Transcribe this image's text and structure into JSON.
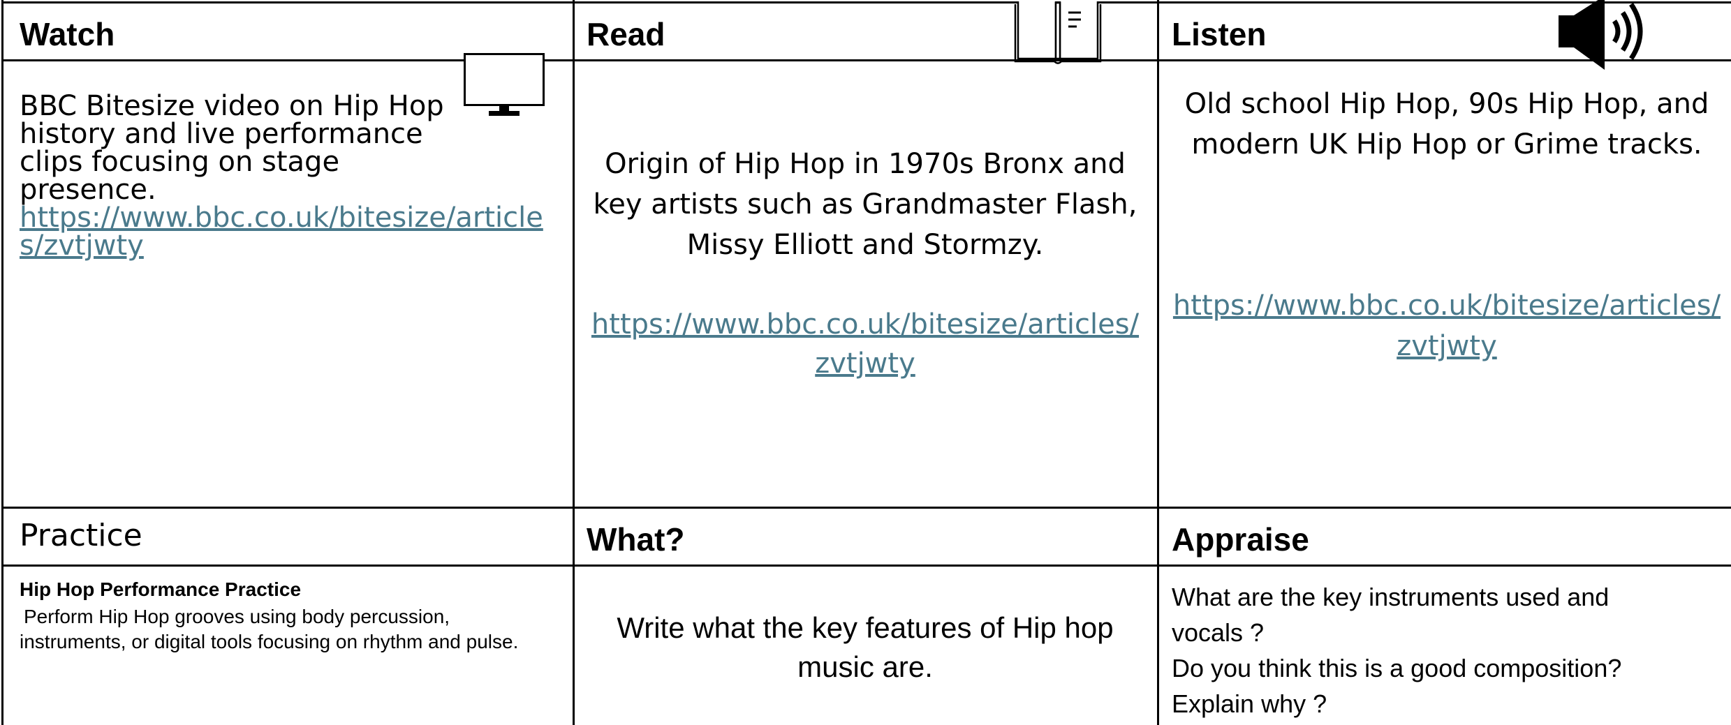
{
  "watch": {
    "header": "Watch",
    "text": "BBC Bitesize video on Hip Hop history and live performance clips focusing on stage presence.",
    "link": "https://www.bbc.co.uk/bitesize/articles/zvtjwty",
    "icon": "monitor-icon"
  },
  "read": {
    "header": "Read",
    "text": "Origin of Hip Hop in 1970s Bronx and key artists such as Grandmaster Flash, Missy Elliott and Stormzy.",
    "link": "https://www.bbc.co.uk/bitesize/articles/zvtjwty",
    "icon": "book-icon"
  },
  "listen": {
    "header": "Listen",
    "text": "Old school Hip Hop, 90s Hip Hop, and modern UK Hip Hop or Grime tracks.",
    "link": "https://www.bbc.co.uk/bitesize/articles/zvtjwty",
    "icon": "speaker-icon"
  },
  "practice": {
    "header": "Practice",
    "title": "Hip Hop Performance Practice",
    "text": "Perform Hip Hop grooves using body percussion, instruments, or digital tools focusing on rhythm and pulse."
  },
  "what": {
    "header": "What?",
    "text": "Write what the key features of Hip hop music are."
  },
  "appraise": {
    "header": "Appraise",
    "lines": [
      "What are the key instruments used and vocals ?",
      "Do you think this is a good composition?",
      "Explain why ?"
    ]
  },
  "colors": {
    "link": "#4a7a8c",
    "border": "#000000"
  }
}
